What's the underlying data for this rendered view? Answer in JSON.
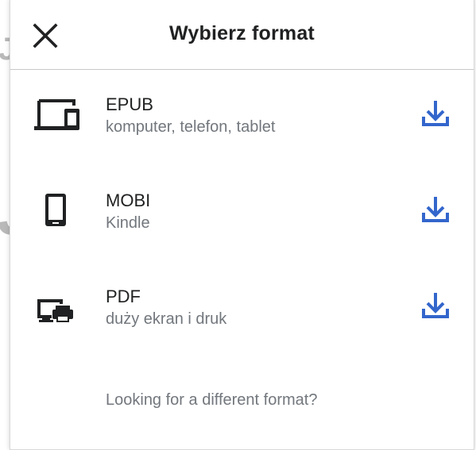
{
  "dialog": {
    "title": "Wybierz format",
    "close_icon": "close-icon",
    "accent_color": "#3366cc"
  },
  "formats": [
    {
      "name": "EPUB",
      "description": "komputer, telefon, tablet",
      "icon": "laptop-phone-icon",
      "action_icon": "download-icon"
    },
    {
      "name": "MOBI",
      "description": "Kindle",
      "icon": "tablet-icon",
      "action_icon": "download-icon"
    },
    {
      "name": "PDF",
      "description": "duży ekran i druk",
      "icon": "monitor-printer-icon",
      "action_icon": "download-icon"
    }
  ],
  "footer": {
    "different_format_text": "Looking for a different format?"
  }
}
